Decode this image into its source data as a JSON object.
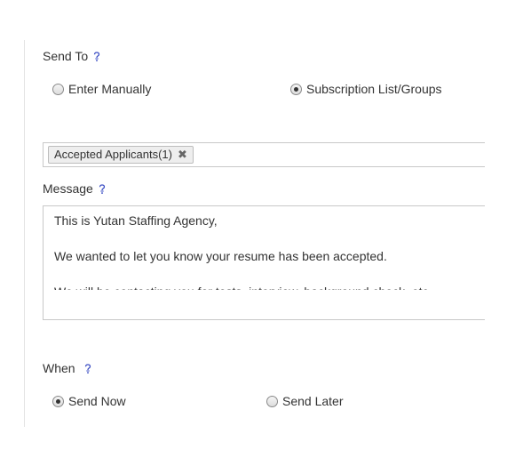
{
  "send_to": {
    "label": "Send To",
    "options": [
      {
        "label": "Enter Manually",
        "selected": false
      },
      {
        "label": "Subscription List/Groups",
        "selected": true
      }
    ]
  },
  "recipients": {
    "tags": [
      {
        "label": "Accepted Applicants(1)",
        "remove_icon": "close-icon"
      }
    ],
    "remove_glyph": "✖"
  },
  "message": {
    "label": "Message",
    "lines": [
      "This is Yutan Staffing Agency,",
      "We wanted to let you know your resume has been accepted.",
      "We will be contacting you for tests, interview, background check, etc."
    ]
  },
  "when": {
    "label": "When",
    "options": [
      {
        "label": "Send Now",
        "selected": true
      },
      {
        "label": "Send Later",
        "selected": false
      }
    ]
  },
  "colors": {
    "help_icon": "#3d4fc4",
    "border": "#c8c8c8",
    "text": "#333333"
  }
}
